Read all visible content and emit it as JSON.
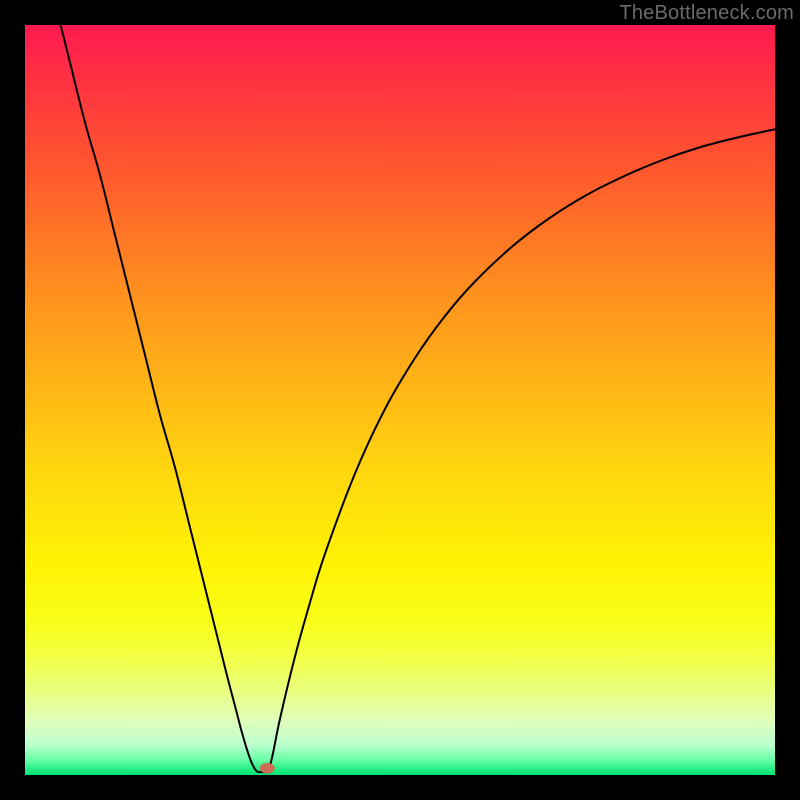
{
  "watermark": "TheBottleneck.com",
  "colors": {
    "frame": "#000000",
    "curve_stroke": "#000000",
    "dot_fill": "#ce6e55",
    "gradient_stops": [
      {
        "pos": 0.0,
        "color": "#ff1a4f"
      },
      {
        "pos": 0.08,
        "color": "#ff3340"
      },
      {
        "pos": 0.2,
        "color": "#ff5a2d"
      },
      {
        "pos": 0.35,
        "color": "#ff8e1f"
      },
      {
        "pos": 0.48,
        "color": "#ffb516"
      },
      {
        "pos": 0.6,
        "color": "#ffd80e"
      },
      {
        "pos": 0.72,
        "color": "#fff304"
      },
      {
        "pos": 0.8,
        "color": "#f8ff1c"
      },
      {
        "pos": 0.85,
        "color": "#f1ff4d"
      },
      {
        "pos": 0.89,
        "color": "#e9ff82"
      },
      {
        "pos": 0.93,
        "color": "#ddffbd"
      },
      {
        "pos": 0.96,
        "color": "#bbffce"
      },
      {
        "pos": 0.98,
        "color": "#66ffa4"
      },
      {
        "pos": 1.0,
        "color": "#00e272"
      }
    ]
  },
  "chart_data": {
    "type": "line",
    "title": "",
    "xlabel": "",
    "ylabel": "",
    "xlim": [
      0,
      100
    ],
    "ylim": [
      0,
      100
    ],
    "grid": false,
    "series": [
      {
        "name": "left-branch",
        "x": [
          4.0,
          6.0,
          8.0,
          10.0,
          12.0,
          14.0,
          16.0,
          18.0,
          20.0,
          22.0,
          24.0,
          26.0,
          27.0,
          28.0,
          29.0,
          30.0,
          30.8
        ],
        "y": [
          103.0,
          95.0,
          87.0,
          80.0,
          72.0,
          64.0,
          56.0,
          48.0,
          41.0,
          33.0,
          25.0,
          17.0,
          13.0,
          9.2,
          5.4,
          2.2,
          0.6
        ]
      },
      {
        "name": "right-branch",
        "x": [
          32.4,
          33.0,
          34.0,
          36.0,
          38.0,
          40.0,
          44.0,
          48.0,
          52.0,
          56.0,
          60.0,
          65.0,
          70.0,
          75.0,
          80.0,
          85.0,
          90.0,
          95.0,
          100.0
        ],
        "y": [
          0.6,
          2.6,
          7.5,
          15.8,
          23.0,
          29.5,
          40.2,
          48.8,
          55.6,
          61.2,
          65.8,
          70.5,
          74.3,
          77.4,
          79.9,
          82.0,
          83.7,
          85.0,
          86.1
        ]
      }
    ],
    "vertex": {
      "x": 31.6,
      "y": 0.4
    },
    "marker": {
      "x": 32.3,
      "y": 0.9,
      "rx": 1.0,
      "ry": 0.7
    }
  }
}
